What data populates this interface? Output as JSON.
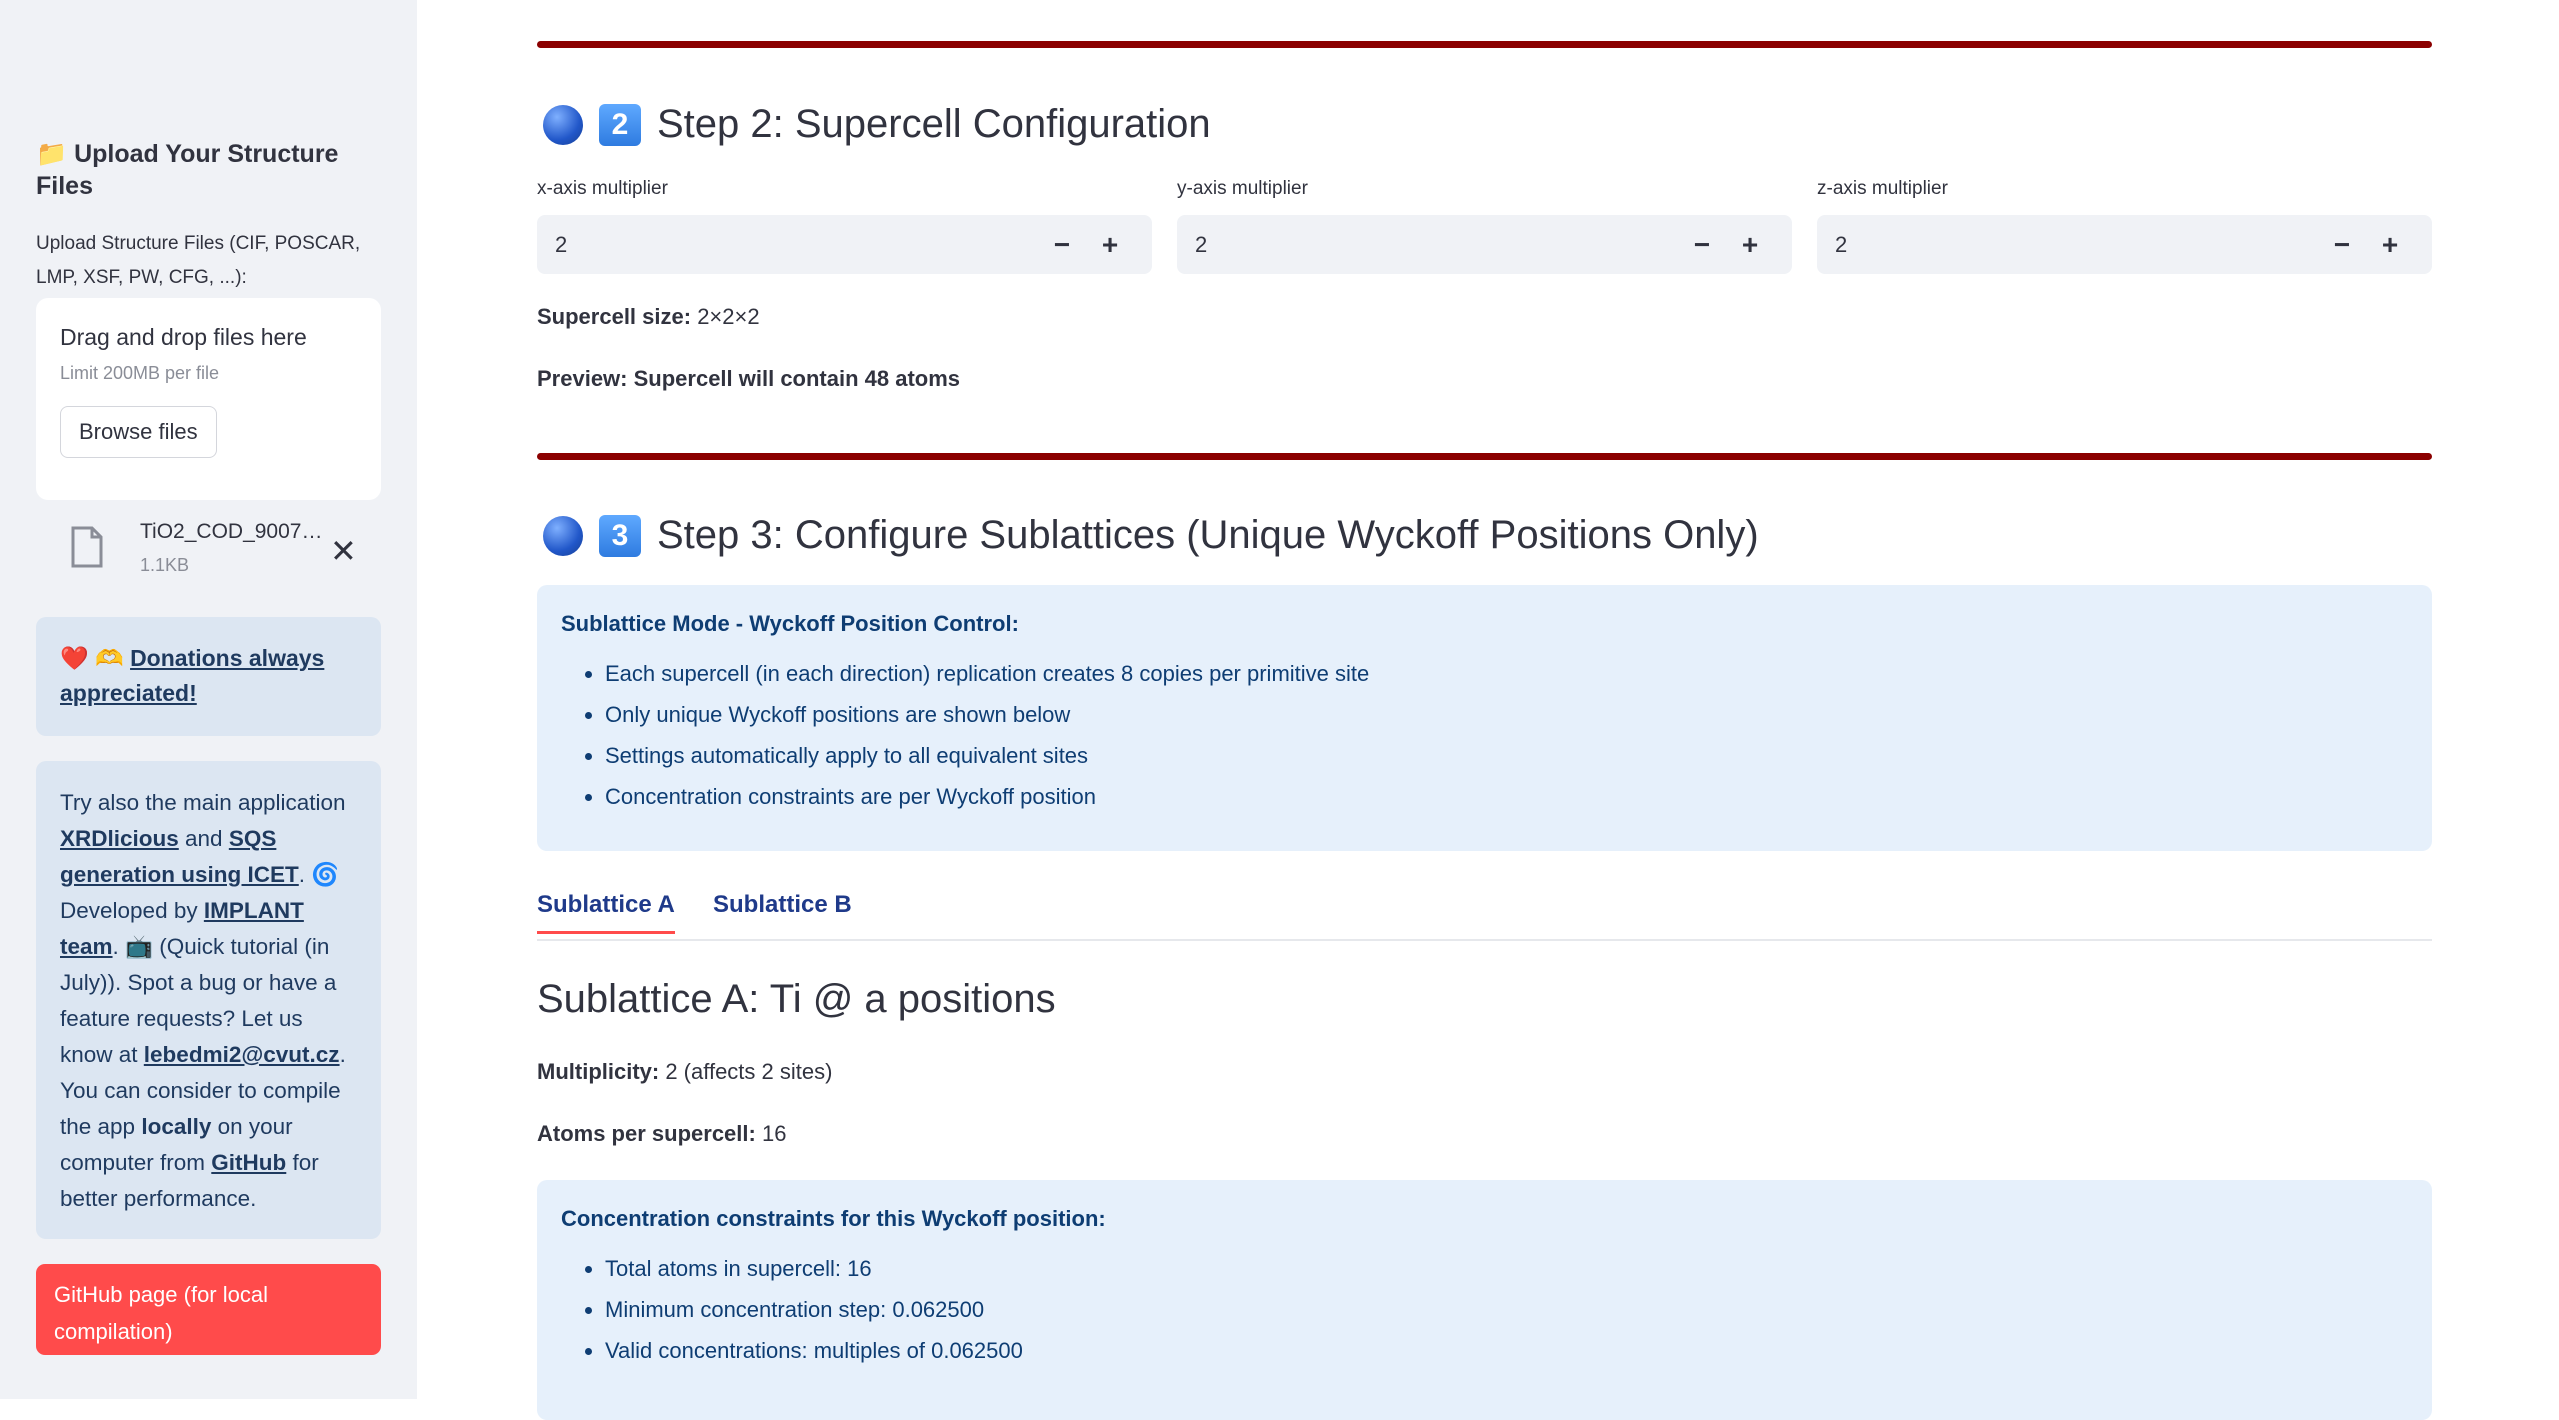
{
  "sidebar": {
    "heading": "📁 Upload Your Structure Files",
    "upload_label": "Upload Structure Files (CIF, POSCAR, LMP, XSF, PW, CFG, ...):",
    "drag_text": "Drag and drop files here",
    "limit_text": "Limit 200MB per file",
    "browse_label": "Browse files",
    "file_name": "TiO2_COD_9007…",
    "file_size": "1.1KB",
    "donate_prefix": "❤️ 🫶",
    "donate_link": "Donations always appreciated!",
    "info": {
      "p1": "Try also the main application ",
      "l1": "XRDlicious",
      "p2": " and ",
      "l2": "SQS generation using ICET",
      "p3": ". 🌀 Developed by ",
      "l3": "IMPLANT team",
      "p4": ". 📺 (Quick tutorial (in July)). Spot a bug or have a feature requests? Let us know at ",
      "l4": "lebedmi2@cvut.cz",
      "p5": ". You can consider to compile the app ",
      "b1": "locally",
      "p6": " on your computer from ",
      "l5": "GitHub",
      "p7": " for better performance."
    },
    "github_button": "GitHub page (for local compilation)"
  },
  "step2": {
    "number": "2",
    "title": "Step 2: Supercell Configuration",
    "x_label": "x-axis multiplier",
    "y_label": "y-axis multiplier",
    "z_label": "z-axis multiplier",
    "x_value": "2",
    "y_value": "2",
    "z_value": "2",
    "minus": "−",
    "plus": "+",
    "size_label": "Supercell size:",
    "size_value": " 2×2×2",
    "preview": "Preview: Supercell will contain 48 atoms"
  },
  "step3": {
    "number": "3",
    "title": "Step 3: Configure Sublattices (Unique Wyckoff Positions Only)",
    "callout_title": "Sublattice Mode - Wyckoff Position Control:",
    "bullets": [
      "Each supercell (in each direction) replication creates 8 copies per primitive site",
      "Only unique Wyckoff positions are shown below",
      "Settings automatically apply to all equivalent sites",
      "Concentration constraints are per Wyckoff position"
    ],
    "tabs": [
      "Sublattice A",
      "Sublattice B"
    ],
    "sub_title": "Sublattice A: Ti @ a positions",
    "multiplicity_label": "Multiplicity:",
    "multiplicity_value": " 2 (affects 2 sites)",
    "atoms_label": "Atoms per supercell:",
    "atoms_value": " 16",
    "constraints_title": "Concentration constraints for this Wyckoff position:",
    "constraints": [
      "Total atoms in supercell: 16",
      "Minimum concentration step: 0.062500",
      "Valid concentrations: multiples of 0.062500"
    ]
  },
  "colors": {
    "rule": "#8b0000",
    "accent": "#ff4b4b",
    "info_bg": "#e6f0fb"
  }
}
